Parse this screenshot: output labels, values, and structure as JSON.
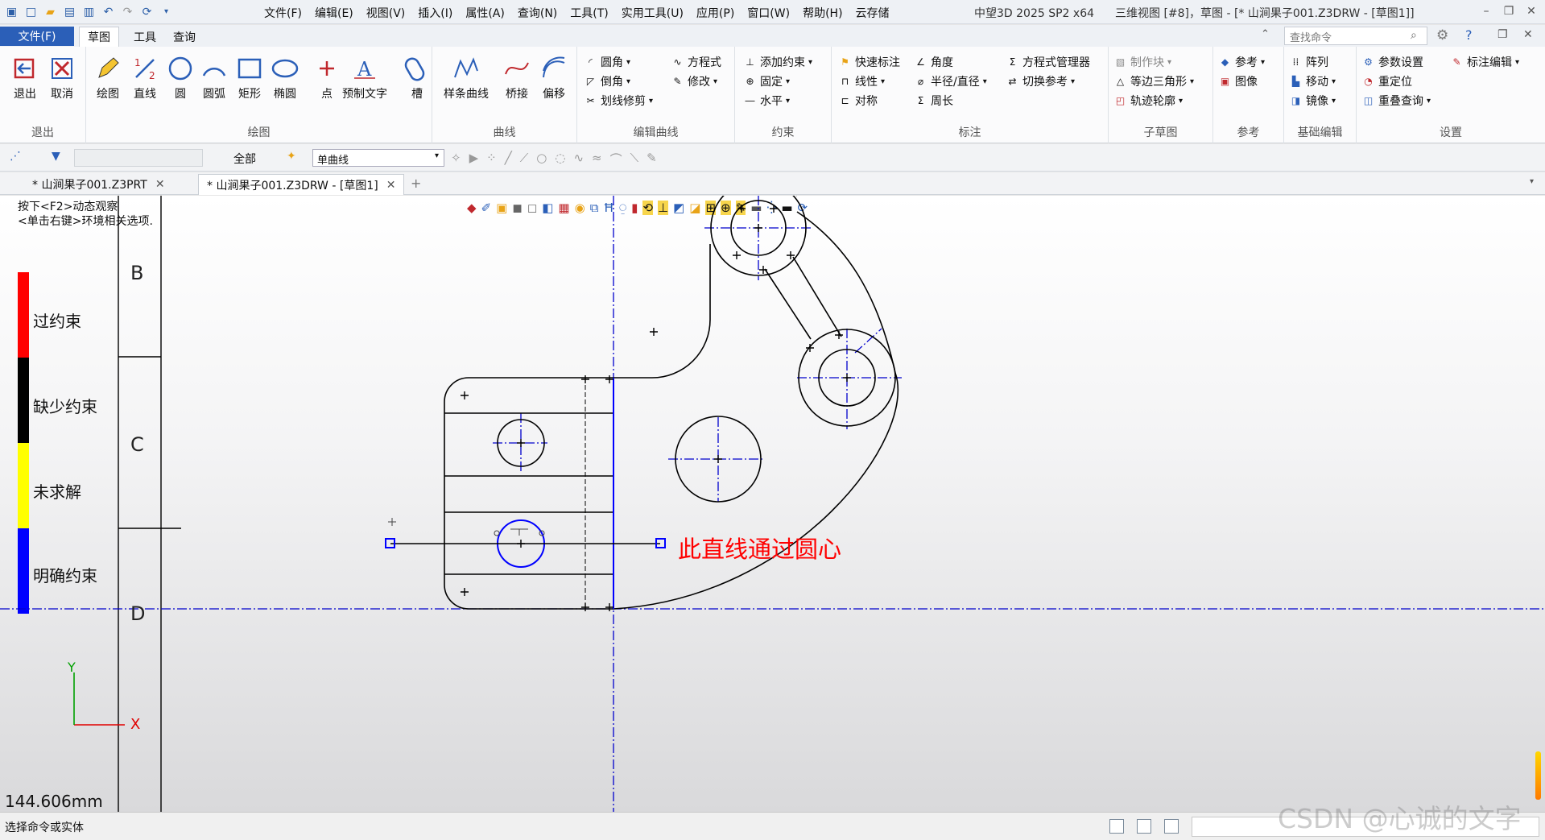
{
  "menubar": {
    "items": [
      "文件(F)",
      "编辑(E)",
      "视图(V)",
      "插入(I)",
      "属性(A)",
      "查询(N)",
      "工具(T)",
      "实用工具(U)",
      "应用(P)",
      "窗口(W)",
      "帮助(H)",
      "云存储"
    ],
    "app_title": "中望3D 2025 SP2 x64",
    "doc_title": "三维视图 [#8]，草图 - [* 山涧果子001.Z3DRW - [草图1]]"
  },
  "ribbon_tabs": {
    "file": "文件(F)",
    "tabs": [
      "草图",
      "工具",
      "查询"
    ],
    "active": "草图",
    "search_placeholder": "查找命令"
  },
  "ribbon": {
    "exit_group": {
      "label": "退出",
      "exit": "退出",
      "cancel": "取消"
    },
    "draw_group": {
      "label": "绘图",
      "buttons": [
        "绘图",
        "直线",
        "圆",
        "圆弧",
        "矩形",
        "椭圆",
        "点",
        "预制文字",
        "槽"
      ]
    },
    "curve_group": {
      "label": "曲线",
      "buttons": [
        "样条曲线",
        "桥接",
        "偏移"
      ]
    },
    "edit_group": {
      "label": "编辑曲线",
      "buttons": [
        "圆角",
        "方程式",
        "倒角",
        "修改",
        "划线修剪"
      ]
    },
    "constraint_group": {
      "label": "约束",
      "buttons": [
        "添加约束",
        "固定",
        "水平"
      ]
    },
    "dim_group": {
      "label": "标注",
      "buttons": [
        "快速标注",
        "角度",
        "方程式管理器",
        "线性",
        "半径/直径",
        "切换参考",
        "对称",
        "周长"
      ]
    },
    "sub_group": {
      "label": "子草图",
      "buttons": [
        "制作块",
        "等边三角形",
        "轨迹轮廓"
      ]
    },
    "ref_group": {
      "label": "参考",
      "buttons": [
        "参考",
        "图像"
      ]
    },
    "base_group": {
      "label": "基础编辑",
      "buttons": [
        "阵列",
        "移动",
        "镜像"
      ]
    },
    "settings_group": {
      "label": "设置",
      "buttons": [
        "参数设置",
        "标注编辑",
        "重定位",
        "重叠查询"
      ]
    }
  },
  "toolbar2": {
    "filter": "全部",
    "curve_type": "单曲线"
  },
  "doc_tabs": [
    "* 山涧果子001.Z3PRT",
    "* 山涧果子001.Z3DRW - [草图1]"
  ],
  "canvas": {
    "hints": [
      "按下<F2>动态观察",
      "<单击右键>环境相关选项."
    ],
    "legend": [
      {
        "label": "过约束",
        "color": "#ff0000"
      },
      {
        "label": "缺少约束",
        "color": "#000000"
      },
      {
        "label": "未求解",
        "color": "#ffff00"
      },
      {
        "label": "明确约束",
        "color": "#0000ff"
      }
    ],
    "border_zones": [
      "B",
      "C",
      "D"
    ],
    "annotation": "此直线通过圆心",
    "measure": "144.606mm",
    "axis_x": "X",
    "axis_y": "Y"
  },
  "statusbar": {
    "message": "选择命令或实体"
  },
  "watermark": "CSDN @心诚的文字"
}
